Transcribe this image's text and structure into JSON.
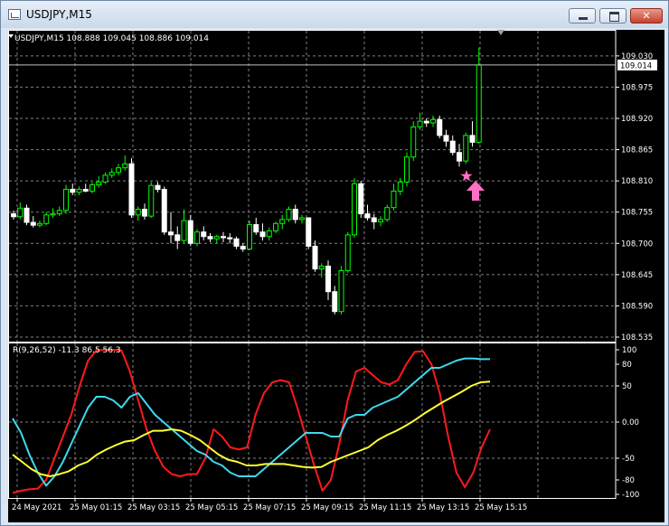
{
  "window": {
    "title": "USDJPY,M15",
    "minimize_icon": "minimize-icon",
    "restore_icon": "restore-icon",
    "close_icon": "close-icon"
  },
  "header": {
    "symbol_info": "USDJPY,M15  108.888 109.045 108.886 109.014"
  },
  "indicator_header": "R(9,26,52) -11.3 86.5 56.3",
  "colors": {
    "background": "#000000",
    "grid": "#7f7f7f",
    "bull_candle": "#00ff00",
    "bear_candle": "#ffffff",
    "line_red": "#ff1a1a",
    "line_cyan": "#3fd9ee",
    "line_yellow": "#ffff33",
    "marker": "#ff6ec7"
  },
  "markers": [
    {
      "type": "star-icon"
    },
    {
      "type": "up-arrow-icon"
    }
  ],
  "chart_data": [
    {
      "type": "candlestick",
      "title": "USDJPY,M15",
      "ylim": [
        108.535,
        109.06
      ],
      "y_ticks": [
        "109.030",
        "108.975",
        "108.920",
        "108.865",
        "108.810",
        "108.755",
        "108.700",
        "108.645",
        "108.590",
        "108.535"
      ],
      "current_price": "109.014",
      "x_ticks": [
        "24 May 2021",
        "25 May 01:15",
        "25 May 03:15",
        "25 May 05:15",
        "25 May 07:15",
        "25 May 09:15",
        "25 May 11:15",
        "25 May 13:15",
        "25 May 15:15"
      ],
      "candles": [
        [
          108.752,
          108.758,
          108.742,
          108.747
        ],
        [
          108.747,
          108.772,
          108.743,
          108.762
        ],
        [
          108.762,
          108.768,
          108.732,
          108.737
        ],
        [
          108.737,
          108.748,
          108.728,
          108.732
        ],
        [
          108.732,
          108.74,
          108.728,
          108.735
        ],
        [
          108.735,
          108.755,
          108.732,
          108.75
        ],
        [
          108.75,
          108.762,
          108.745,
          108.752
        ],
        [
          108.752,
          108.765,
          108.748,
          108.758
        ],
        [
          108.758,
          108.803,
          108.752,
          108.795
        ],
        [
          108.795,
          108.805,
          108.785,
          108.79
        ],
        [
          108.79,
          108.8,
          108.785,
          108.795
        ],
        [
          108.795,
          108.805,
          108.79,
          108.792
        ],
        [
          108.792,
          108.808,
          108.788,
          108.803
        ],
        [
          108.803,
          108.818,
          108.798,
          108.808
        ],
        [
          108.808,
          108.825,
          108.805,
          108.82
        ],
        [
          108.82,
          108.832,
          108.815,
          108.825
        ],
        [
          108.825,
          108.84,
          108.82,
          108.833
        ],
        [
          108.833,
          108.855,
          108.828,
          108.84
        ],
        [
          108.84,
          108.85,
          108.745,
          108.75
        ],
        [
          108.75,
          108.765,
          108.74,
          108.76
        ],
        [
          108.76,
          108.77,
          108.742,
          108.748
        ],
        [
          108.748,
          108.808,
          108.745,
          108.802
        ],
        [
          108.802,
          108.808,
          108.79,
          108.795
        ],
        [
          108.795,
          108.8,
          108.715,
          108.72
        ],
        [
          108.72,
          108.755,
          108.7,
          108.715
        ],
        [
          108.715,
          108.73,
          108.69,
          108.705
        ],
        [
          108.705,
          108.76,
          108.7,
          108.74
        ],
        [
          108.74,
          108.75,
          108.695,
          108.7
        ],
        [
          108.7,
          108.725,
          108.695,
          108.72
        ],
        [
          108.72,
          108.73,
          108.705,
          108.712
        ],
        [
          108.712,
          108.718,
          108.702,
          108.708
        ],
        [
          108.708,
          108.715,
          108.7,
          108.712
        ],
        [
          108.712,
          108.72,
          108.702,
          108.71
        ],
        [
          108.71,
          108.718,
          108.7,
          108.708
        ],
        [
          108.708,
          108.712,
          108.69,
          108.695
        ],
        [
          108.695,
          108.7,
          108.685,
          108.69
        ],
        [
          108.69,
          108.74,
          108.688,
          108.733
        ],
        [
          108.733,
          108.745,
          108.715,
          108.72
        ],
        [
          108.72,
          108.735,
          108.705,
          108.712
        ],
        [
          108.712,
          108.728,
          108.705,
          108.722
        ],
        [
          108.722,
          108.738,
          108.718,
          108.735
        ],
        [
          108.735,
          108.75,
          108.725,
          108.742
        ],
        [
          108.742,
          108.765,
          108.738,
          108.76
        ],
        [
          108.76,
          108.768,
          108.735,
          108.742
        ],
        [
          108.742,
          108.75,
          108.735,
          108.745
        ],
        [
          108.745,
          108.74,
          108.69,
          108.695
        ],
        [
          108.695,
          108.705,
          108.65,
          108.655
        ],
        [
          108.655,
          108.665,
          108.64,
          108.66
        ],
        [
          108.66,
          108.67,
          108.6,
          108.615
        ],
        [
          108.615,
          108.625,
          108.575,
          108.58
        ],
        [
          108.58,
          108.66,
          108.575,
          108.652
        ],
        [
          108.652,
          108.72,
          108.648,
          108.715
        ],
        [
          108.715,
          108.815,
          108.71,
          108.805
        ],
        [
          108.805,
          108.81,
          108.745,
          108.752
        ],
        [
          108.752,
          108.768,
          108.74,
          108.745
        ],
        [
          108.745,
          108.752,
          108.725,
          108.738
        ],
        [
          108.738,
          108.748,
          108.73,
          108.742
        ],
        [
          108.742,
          108.768,
          108.738,
          108.763
        ],
        [
          108.763,
          108.805,
          108.758,
          108.792
        ],
        [
          108.792,
          108.815,
          108.785,
          108.808
        ],
        [
          108.808,
          108.86,
          108.8,
          108.852
        ],
        [
          108.852,
          108.915,
          108.845,
          108.905
        ],
        [
          108.905,
          108.93,
          108.9,
          108.915
        ],
        [
          108.915,
          108.92,
          108.905,
          108.912
        ],
        [
          108.912,
          108.925,
          108.905,
          108.918
        ],
        [
          108.918,
          108.925,
          108.885,
          108.89
        ],
        [
          108.89,
          108.9,
          108.87,
          108.88
        ],
        [
          108.88,
          108.89,
          108.855,
          108.86
        ],
        [
          108.86,
          108.875,
          108.835,
          108.845
        ],
        [
          108.845,
          108.895,
          108.84,
          108.89
        ],
        [
          108.89,
          108.915,
          108.87,
          108.878
        ],
        [
          108.878,
          109.045,
          108.875,
          109.014
        ]
      ]
    },
    {
      "type": "line",
      "title": "R(9,26,52) -11.3 86.5 56.3",
      "ylim": [
        -105,
        105
      ],
      "y_ticks": [
        "100",
        "80",
        "50",
        "0.00",
        "-50",
        "-80",
        "-100"
      ],
      "series": [
        {
          "color": "red",
          "values": [
            -98,
            -95,
            -93,
            -92,
            -80,
            -50,
            -20,
            10,
            50,
            85,
            99,
            100,
            100,
            99,
            70,
            30,
            -10,
            -40,
            -62,
            -72,
            -75,
            -72,
            -72,
            -50,
            -10,
            -20,
            -35,
            -38,
            -35,
            10,
            40,
            55,
            58,
            55,
            20,
            -20,
            -60,
            -95,
            -80,
            -30,
            30,
            70,
            75,
            65,
            55,
            52,
            58,
            80,
            97,
            98,
            80,
            40,
            -20,
            -70,
            -90,
            -70,
            -35,
            -10
          ]
        },
        {
          "color": "cyan",
          "values": [
            5,
            -15,
            -45,
            -70,
            -88,
            -75,
            -55,
            -30,
            -5,
            20,
            35,
            35,
            30,
            20,
            35,
            40,
            25,
            10,
            0,
            -10,
            -20,
            -30,
            -40,
            -45,
            -55,
            -60,
            -70,
            -75,
            -75,
            -75,
            -65,
            -55,
            -45,
            -35,
            -25,
            -15,
            -15,
            -15,
            -20,
            -20,
            5,
            10,
            10,
            20,
            25,
            30,
            35,
            45,
            55,
            65,
            75,
            75,
            80,
            85,
            88,
            88,
            87,
            87
          ]
        },
        {
          "color": "yellow",
          "values": [
            -45,
            -55,
            -65,
            -72,
            -75,
            -72,
            -68,
            -60,
            -55,
            -45,
            -38,
            -32,
            -27,
            -25,
            -18,
            -12,
            -12,
            -10,
            -12,
            -18,
            -25,
            -35,
            -45,
            -52,
            -55,
            -60,
            -60,
            -58,
            -58,
            -58,
            -60,
            -62,
            -63,
            -62,
            -55,
            -50,
            -45,
            -40,
            -35,
            -25,
            -18,
            -12,
            -5,
            3,
            12,
            20,
            28,
            35,
            42,
            50,
            55,
            56
          ]
        }
      ]
    }
  ]
}
